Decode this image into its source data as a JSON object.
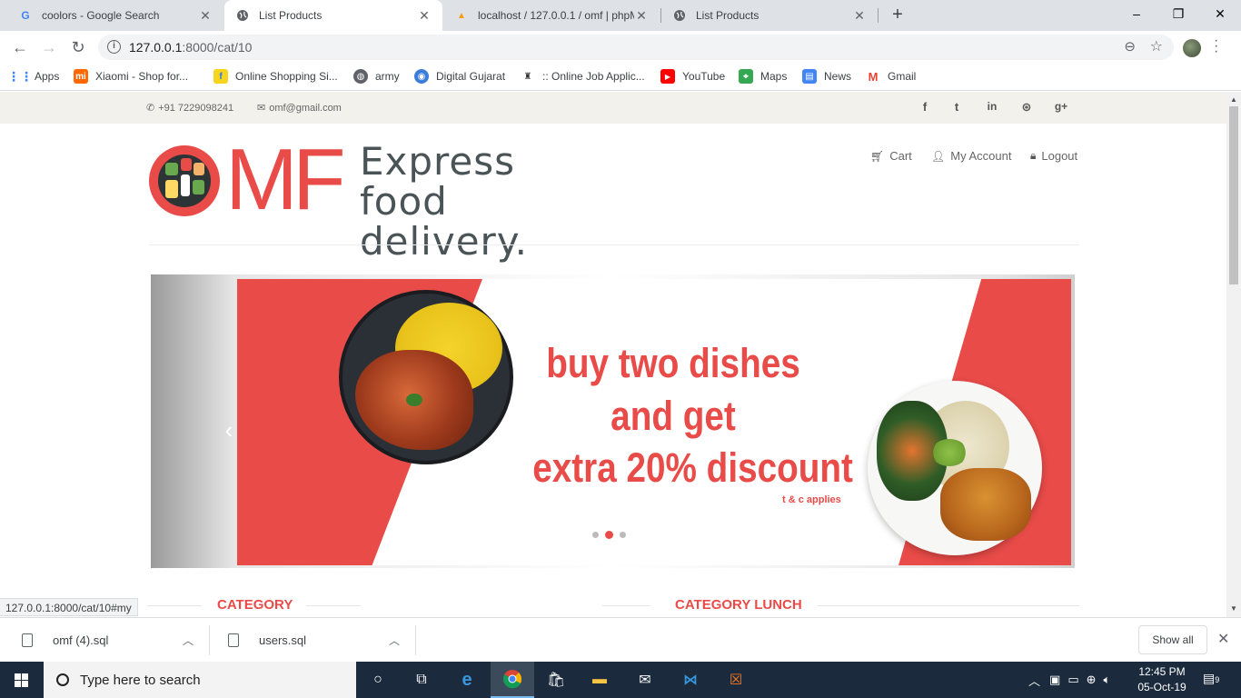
{
  "browser": {
    "tabs": [
      {
        "title": "coolors - Google Search",
        "icon": "google-icon",
        "active": false
      },
      {
        "title": "List Products",
        "icon": "globe-icon",
        "active": true
      },
      {
        "title": "localhost / 127.0.0.1 / omf | phpM",
        "icon": "phpmyadmin-icon",
        "active": false
      },
      {
        "title": "List Products",
        "icon": "globe-icon",
        "active": false
      }
    ],
    "url_host": "127.0.0.1",
    "url_rest": ":8000/cat/10",
    "bookmarks": [
      {
        "label": "Apps",
        "icon": "apps-grid-icon",
        "color": "#4285f4"
      },
      {
        "label": "Xiaomi - Shop for...",
        "icon": "mi-icon",
        "color": "#ff6700"
      },
      {
        "label": "Online Shopping Si...",
        "icon": "flipkart-icon",
        "color": "#f7d51d"
      },
      {
        "label": "army",
        "icon": "globe-icon",
        "color": "#5f6368"
      },
      {
        "label": "Digital Gujarat",
        "icon": "digital-gujarat-icon",
        "color": "#3b7dd8"
      },
      {
        "label": ":: Online Job Applic...",
        "icon": "emblem-icon",
        "color": "#333333"
      },
      {
        "label": "YouTube",
        "icon": "youtube-icon",
        "color": "#ff0000"
      },
      {
        "label": "Maps",
        "icon": "maps-icon",
        "color": "#34a853"
      },
      {
        "label": "News",
        "icon": "news-icon",
        "color": "#4285f4"
      },
      {
        "label": "Gmail",
        "icon": "gmail-icon",
        "color": "#ea4335"
      }
    ],
    "status_url": "127.0.0.1:8000/cat/10#my"
  },
  "site": {
    "phone": "+91 7229098241",
    "email": "omf@gmail.com",
    "social": [
      "f",
      "t",
      "in",
      "⊛",
      "g+"
    ],
    "logo_letters": "MF",
    "tagline_1": "Express food",
    "tagline_2": "delivery.",
    "nav": {
      "cart": "Cart",
      "account": "My Account",
      "logout": "Logout"
    },
    "slider": {
      "line1": "buy two dishes",
      "line2": "and get",
      "line3": "extra 20% discount",
      "terms": "t & c applies",
      "dot_count": 3,
      "active_dot": 2
    },
    "categories": {
      "left": "CATEGORY",
      "right": "CATEGORY LUNCH"
    },
    "accent_color": "#e84b48"
  },
  "downloads": {
    "items": [
      "omf (4).sql",
      "users.sql"
    ],
    "show_all": "Show all"
  },
  "taskbar": {
    "search_placeholder": "Type here to search",
    "time": "12:45 PM",
    "date": "05-Oct-19",
    "notification_count": "9"
  }
}
